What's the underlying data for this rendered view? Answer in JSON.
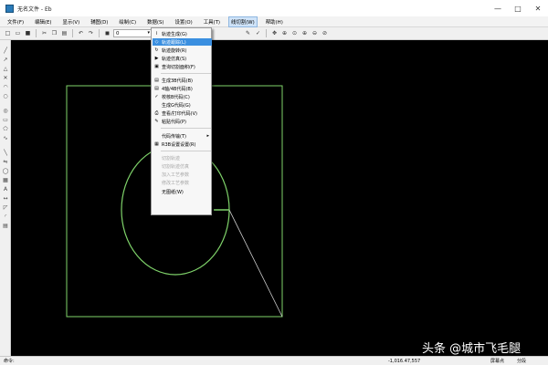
{
  "window": {
    "title": "无名文件 - Eb",
    "controls": [
      "—",
      "□",
      "✕"
    ]
  },
  "menubar": {
    "items": [
      "文件(F)",
      "编辑(E)",
      "显示(V)",
      "辅图(D)",
      "绘制(C)",
      "数据(S)",
      "设置(O)",
      "工具(T)",
      "线切割(W)",
      "帮助(H)"
    ],
    "active_index": 8
  },
  "toolbar": {
    "layer_value": "0"
  },
  "dropdown": {
    "items": [
      {
        "label": "轨迹生成(G)",
        "icon": "track-icon",
        "state": "normal"
      },
      {
        "label": "轨迹跟踪(L)",
        "icon": "follow-icon",
        "state": "highlighted"
      },
      {
        "label": "轨迹旋转(R)",
        "icon": "rotate-icon",
        "state": "normal"
      },
      {
        "label": "轨迹仿真(S)",
        "icon": "simulate-icon",
        "state": "normal"
      },
      {
        "label": "查询切割面积(F)",
        "icon": "area-icon",
        "state": "normal"
      },
      {
        "label": "生成3B代码(B)",
        "icon": "code-icon",
        "state": "normal"
      },
      {
        "label": "4轴/4B代码(B)",
        "icon": "code-icon",
        "state": "normal"
      },
      {
        "label": "校核B代码(C)",
        "icon": "check-icon",
        "state": "normal"
      },
      {
        "label": "生成G代码(G)",
        "icon": "code-icon",
        "state": "normal"
      },
      {
        "label": "查看/打印代码(V)",
        "icon": "print-icon",
        "state": "normal"
      },
      {
        "label": "粘贴代码(P)",
        "icon": "paste-icon",
        "state": "normal"
      },
      {
        "label": "代码传输(T)",
        "icon": "",
        "state": "normal",
        "submenu": true
      },
      {
        "label": "R3B设置设置(R)",
        "icon": "settings-icon",
        "state": "normal"
      },
      {
        "label": "切割轨迹",
        "icon": "",
        "state": "disabled"
      },
      {
        "label": "切割轨迹仿真",
        "icon": "",
        "state": "disabled"
      },
      {
        "label": "加入工艺参数",
        "icon": "",
        "state": "disabled"
      },
      {
        "label": "修改工艺参数",
        "icon": "",
        "state": "disabled"
      },
      {
        "label": "无图纸(W)",
        "icon": "",
        "state": "normal"
      }
    ]
  },
  "statusbar": {
    "ready": "命令:",
    "coords": "-1,016.47,557",
    "mode": "屏幕点",
    "cell": "分段"
  },
  "canvas": {
    "geometry_color": "#7fd36a",
    "background": "#000000"
  },
  "watermark": "头条 @城市飞毛腿"
}
